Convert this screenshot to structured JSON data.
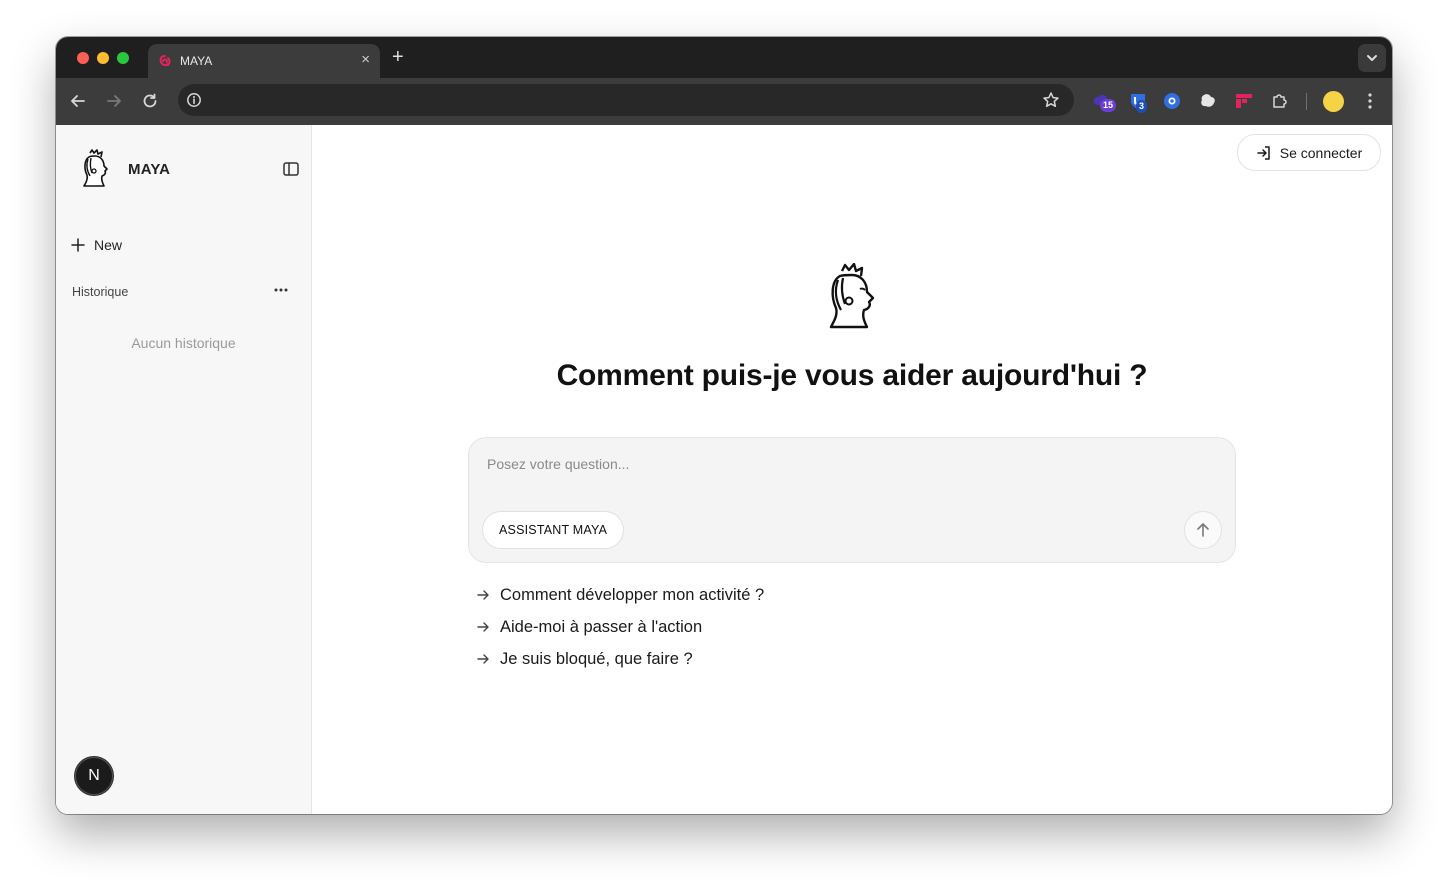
{
  "browser": {
    "tab_title": "MAYA",
    "tab_close": "×",
    "new_tab": "+",
    "extension_badges": [
      "15",
      "3"
    ],
    "colors": {
      "brand_favicon": "#e0245e",
      "ext_purple": "#6b3fd1",
      "ext_blue": "#2f6fe0"
    }
  },
  "sidebar": {
    "brand_name": "MAYA",
    "new_label": "New",
    "history_label": "Historique",
    "history_empty": "Aucun historique",
    "user_initial": "N"
  },
  "main": {
    "login_label": "Se connecter",
    "title": "Comment puis-je vous aider aujourd'hui ?",
    "input_placeholder": "Posez votre question...",
    "assistant_label": "ASSISTANT MAYA",
    "suggestions": [
      "Comment développer mon activité ?",
      "Aide-moi à passer à l'action",
      "Je suis bloqué, que faire ?"
    ]
  }
}
